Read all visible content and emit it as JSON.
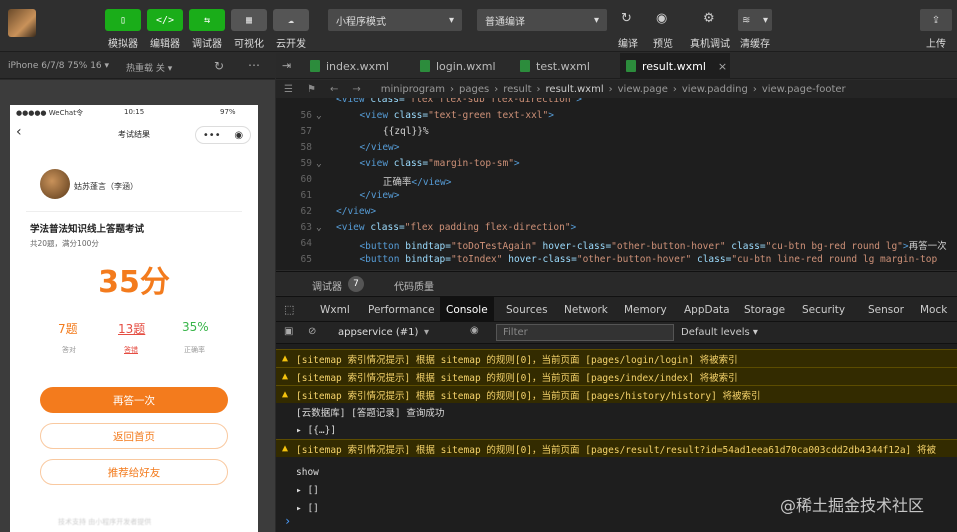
{
  "toolbar": {
    "buttons": [
      {
        "label": "模拟器",
        "glyph": "▯"
      },
      {
        "label": "编辑器",
        "glyph": "</>"
      },
      {
        "label": "调试器",
        "glyph": "⇆"
      },
      {
        "label": "可视化",
        "glyph": "▦"
      },
      {
        "label": "云开发",
        "glyph": "☁"
      }
    ],
    "mode_select": "小程序模式",
    "compile_select": "普通编译",
    "right_buttons": [
      {
        "label": "编译",
        "glyph": "↻"
      },
      {
        "label": "预览",
        "glyph": "◉"
      },
      {
        "label": "真机调试",
        "glyph": "⚙"
      },
      {
        "label": "清缓存",
        "glyph": "≋"
      }
    ],
    "upload_label": "上传",
    "upload_glyph": "⇪"
  },
  "simulator": {
    "device": "iPhone 6/7/8 75% 16 ▾",
    "hotreload": "热重载 关 ▾",
    "statusbar": {
      "carrier": "●●●●● WeChat令",
      "time": "10:15",
      "battery": "97%"
    },
    "nav_title": "考试结果",
    "user_name": "姑苏蓬言（李涵）",
    "exam_title": "学法普法知识线上答题考试",
    "exam_sub": "共20题，满分100分",
    "score": "35分",
    "stats": [
      {
        "value": "7题",
        "label": "答对"
      },
      {
        "value": "13题",
        "label": "答错"
      },
      {
        "value": "35%",
        "label": "正确率"
      }
    ],
    "btn_retry": "再答一次",
    "btn_home": "返回首页",
    "btn_share": "推荐给好友",
    "footer_text": "技术支持 由小程序开发者提供"
  },
  "editor": {
    "tabs": [
      "index.wxml",
      "login.wxml",
      "test.wxml",
      "result.wxml"
    ],
    "active_tab": "result.wxml",
    "breadcrumb": [
      "miniprogram",
      "pages",
      "result",
      "result.wxml",
      "view.page",
      "view.padding",
      "view.page-footer"
    ],
    "code_lines": [
      {
        "n": "",
        "fold": "",
        "html": "<span class=\"tg\">&lt;view</span> <span class=\"at\">class=</span><span class=\"st\">\"flex flex-sub flex-direction\"</span><span class=\"tg\">&gt;</span>",
        "indent": 0
      },
      {
        "n": "56",
        "fold": "⌄",
        "html": "  <span class=\"tg\">&lt;view</span> <span class=\"at\">class=</span><span class=\"st\">\"text-green text-xxl\"</span><span class=\"tg\">&gt;</span>",
        "indent": 1
      },
      {
        "n": "57",
        "fold": "",
        "html": "    <span class=\"tx\">{{zql}}%</span>",
        "indent": 2
      },
      {
        "n": "58",
        "fold": "",
        "html": "  <span class=\"tg\">&lt;/view&gt;</span>",
        "indent": 1
      },
      {
        "n": "59",
        "fold": "⌄",
        "html": "  <span class=\"tg\">&lt;view</span> <span class=\"at\">class=</span><span class=\"st\">\"margin-top-sm\"</span><span class=\"tg\">&gt;</span>",
        "indent": 1
      },
      {
        "n": "60",
        "fold": "",
        "html": "    <span class=\"tx\">正确率</span><span class=\"tg\">&lt;/view&gt;</span>",
        "indent": 2
      },
      {
        "n": "61",
        "fold": "",
        "html": "  <span class=\"tg\">&lt;/view&gt;</span>",
        "indent": 1
      },
      {
        "n": "62",
        "fold": "",
        "html": "<span class=\"tg\">&lt;/view&gt;</span>",
        "indent": 0
      },
      {
        "n": "63",
        "fold": "⌄",
        "html": "<span class=\"tg\">&lt;view</span> <span class=\"at\">class=</span><span class=\"st\">\"flex padding flex-direction\"</span><span class=\"tg\">&gt;</span>",
        "indent": 0
      },
      {
        "n": "64",
        "fold": "",
        "html": "  <span class=\"tg\">&lt;button</span> <span class=\"at\">bindtap=</span><span class=\"st\">\"toDoTestAgain\"</span> <span class=\"at\">hover-class=</span><span class=\"st\">\"other-button-hover\"</span> <span class=\"at\">class=</span><span class=\"st\">\"cu-btn bg-red round lg\"</span><span class=\"tg\">&gt;</span><span class=\"tx\">再答一次</span>",
        "indent": 1
      },
      {
        "n": "65",
        "fold": "",
        "html": "  <span class=\"tg\">&lt;button</span> <span class=\"at\">bindtap=</span><span class=\"st\">\"toIndex\"</span> <span class=\"at\">hover-class=</span><span class=\"st\">\"other-button-hover\"</span> <span class=\"at\">class=</span><span class=\"st\">\"cu-btn line-red round lg margin-top</span>",
        "indent": 1
      }
    ]
  },
  "devtools": {
    "tab_debugger": "调试器",
    "badge": "7",
    "tab_quality": "代码质量",
    "panel_tabs": [
      "Wxml",
      "Performance",
      "Console",
      "Sources",
      "Network",
      "Memory",
      "AppData",
      "Storage",
      "Security",
      "Sensor",
      "Mock"
    ],
    "active_panel": "Console",
    "context": "appservice (#1)",
    "filter_placeholder": "Filter",
    "levels": "Default levels ▾",
    "console_lines": [
      {
        "type": "warn",
        "text": "[sitemap 索引情况提示] 根据 sitemap 的规则[0]，当前页面 [pages/login/login] 将被索引"
      },
      {
        "type": "warn",
        "text": "[sitemap 索引情况提示] 根据 sitemap 的规则[0]，当前页面 [pages/index/index] 将被索引"
      },
      {
        "type": "warn",
        "text": "[sitemap 索引情况提示] 根据 sitemap 的规则[0]，当前页面 [pages/history/history] 将被索引"
      },
      {
        "type": "info",
        "text": "[云数据库] [答题记录] 查询成功"
      },
      {
        "type": "info",
        "text": "▸ [{…}]"
      },
      {
        "type": "warn",
        "text": "[sitemap 索引情况提示] 根据 sitemap 的规则[0]，当前页面 [pages/result/result?id=54ad1eea61d70ca003cdd2db4344f12a] 将被"
      },
      {
        "type": "info",
        "text": "show"
      },
      {
        "type": "info",
        "text": "▸ []"
      },
      {
        "type": "info",
        "text": "▸ []"
      }
    ],
    "prompt": "›"
  },
  "watermark": "@稀土掘金技术社区",
  "colors": {
    "green": "#1aad19",
    "orange": "#f37b1d",
    "red": "#e54d42",
    "accent_green": "#39b54a"
  }
}
